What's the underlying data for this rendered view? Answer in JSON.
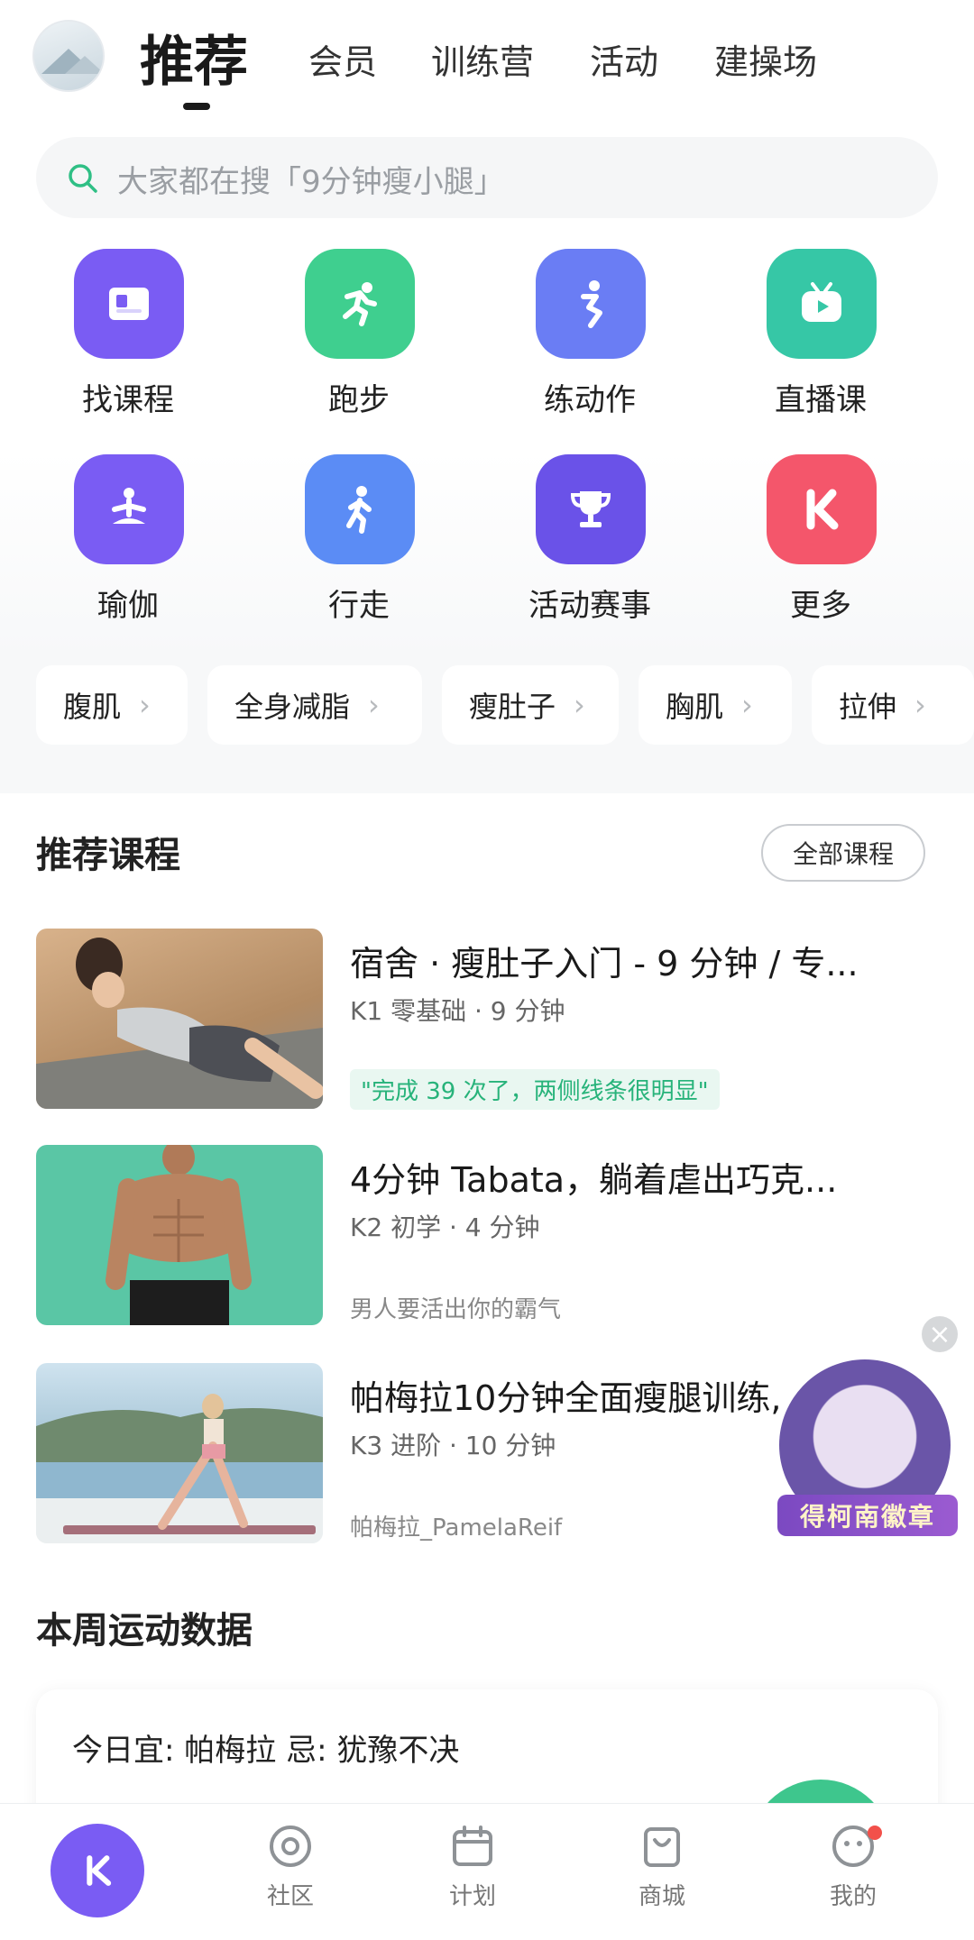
{
  "top_tabs": [
    "推荐",
    "会员",
    "训练营",
    "活动",
    "建操场"
  ],
  "search": {
    "placeholder": "大家都在搜「9分钟瘦小腿」"
  },
  "shortcuts": [
    {
      "label": "找课程",
      "icon": "book-icon",
      "color": "#7a5cf3"
    },
    {
      "label": "跑步",
      "icon": "running-icon",
      "color": "#3fcf8f"
    },
    {
      "label": "练动作",
      "icon": "exercise-icon",
      "color": "#6a7df4"
    },
    {
      "label": "直播课",
      "icon": "tv-play-icon",
      "color": "#36c7a6"
    },
    {
      "label": "瑜伽",
      "icon": "yoga-icon",
      "color": "#7a5cf3"
    },
    {
      "label": "行走",
      "icon": "walking-icon",
      "color": "#5b8cf5"
    },
    {
      "label": "活动赛事",
      "icon": "trophy-icon",
      "color": "#6a52e8"
    },
    {
      "label": "更多",
      "icon": "keep-logo-icon",
      "color": "#f4566b"
    }
  ],
  "chips": [
    "腹肌",
    "全身减脂",
    "瘦肚子",
    "胸肌",
    "拉伸"
  ],
  "recommended": {
    "title": "推荐课程",
    "all_button": "全部课程",
    "courses": [
      {
        "title": "宿舍 · 瘦肚子入门 - 9 分钟 / 专...",
        "meta": "K1 零基础 · 9 分钟",
        "note": "\"完成 39 次了，两侧线条很明显\""
      },
      {
        "title": "4分钟 Tabata，躺着虐出巧克...",
        "meta": "K2 初学 · 4 分钟",
        "note": "男人要活出你的霸气"
      },
      {
        "title": "帕梅拉10分钟全面瘦腿训练,",
        "meta": "K3 进阶 · 10 分钟",
        "note": "帕梅拉_PamelaReif"
      }
    ]
  },
  "float_badge": {
    "label": "得柯南徽章",
    "close": "×"
  },
  "weekly": {
    "title": "本周运动数据",
    "tip": "今日宜: 帕梅拉 忌: 犹豫不决"
  },
  "tabbar": {
    "home": "K",
    "items": [
      "社区",
      "计划",
      "商城",
      "我的"
    ]
  }
}
